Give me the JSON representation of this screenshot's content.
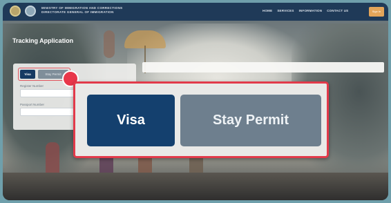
{
  "header": {
    "org_line1": "MINISTRY OF IMMIGRATION AND CORRECTIONS",
    "org_line2": "DIRECTORATE GENERAL OF IMMIGRATION",
    "nav": [
      "HOME",
      "SERVICES",
      "INFORMATION",
      "CONTACT US"
    ],
    "signin_label": "Sign In"
  },
  "page": {
    "title": "Tracking Application"
  },
  "form": {
    "tab_visa": "Visa",
    "tab_stay_permit": "Stay Permit",
    "field1_label": "Register Number",
    "field2_label": "Passport Number"
  },
  "callout": {
    "visa_label": "Visa",
    "stay_permit_label": "Stay Permit"
  },
  "colors": {
    "nav_bg": "#1f3a58",
    "visa_selected": "#14406e",
    "stay_unselected": "#6e7f8e",
    "highlight": "#e23a4a",
    "signin": "#e3a55a"
  },
  "icons": [
    "ministry-logo-icon",
    "immigration-logo-icon",
    "step-marker-icon"
  ]
}
